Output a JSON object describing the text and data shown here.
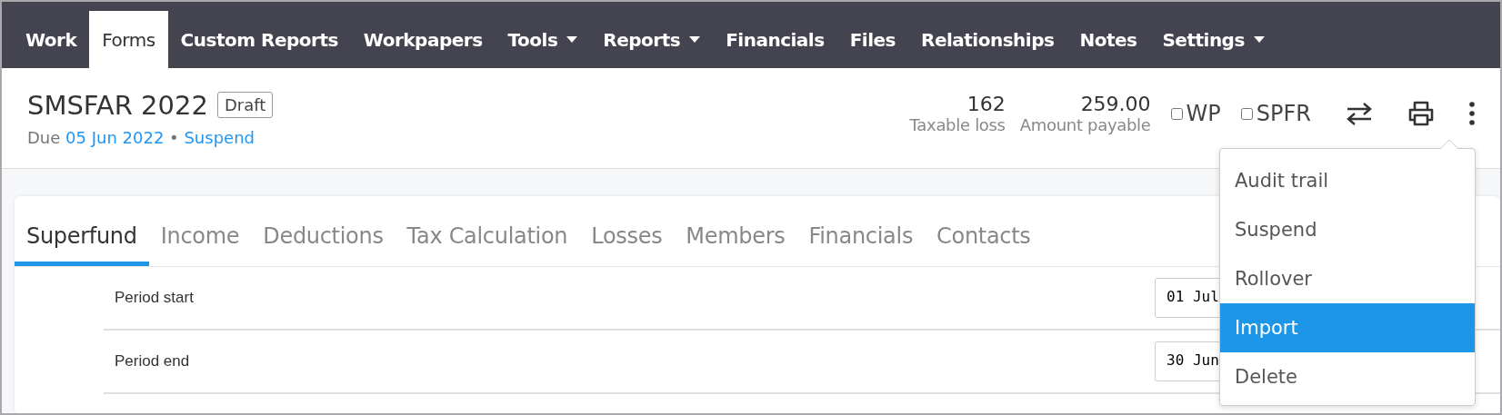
{
  "nav": [
    {
      "label": "Work",
      "selected": false,
      "dropdown": false
    },
    {
      "label": "Forms",
      "selected": true,
      "dropdown": false
    },
    {
      "label": "Custom Reports",
      "selected": false,
      "dropdown": false
    },
    {
      "label": "Workpapers",
      "selected": false,
      "dropdown": false
    },
    {
      "label": "Tools",
      "selected": false,
      "dropdown": true
    },
    {
      "label": "Reports",
      "selected": false,
      "dropdown": true
    },
    {
      "label": "Financials",
      "selected": false,
      "dropdown": false
    },
    {
      "label": "Files",
      "selected": false,
      "dropdown": false
    },
    {
      "label": "Relationships",
      "selected": false,
      "dropdown": false
    },
    {
      "label": "Notes",
      "selected": false,
      "dropdown": false
    },
    {
      "label": "Settings",
      "selected": false,
      "dropdown": true
    }
  ],
  "header": {
    "title": "SMSFAR 2022",
    "badge": "Draft",
    "due_label": "Due",
    "due_date": "05 Jun 2022",
    "separator": "•",
    "suspend_link": "Suspend",
    "stats": [
      {
        "value": "162",
        "label": "Taxable loss"
      },
      {
        "value": "259.00",
        "label": "Amount payable"
      }
    ],
    "checks": [
      {
        "label": "WP",
        "checked": false
      },
      {
        "label": "SPFR",
        "checked": false
      }
    ]
  },
  "tabs": [
    {
      "label": "Superfund",
      "selected": true
    },
    {
      "label": "Income",
      "selected": false
    },
    {
      "label": "Deductions",
      "selected": false
    },
    {
      "label": "Tax Calculation",
      "selected": false
    },
    {
      "label": "Losses",
      "selected": false
    },
    {
      "label": "Members",
      "selected": false
    },
    {
      "label": "Financials",
      "selected": false
    },
    {
      "label": "Contacts",
      "selected": false
    }
  ],
  "rows": [
    {
      "label": "Period start",
      "value": "01 Jul"
    },
    {
      "label": "Period end",
      "value": "30 Jun"
    }
  ],
  "menu": [
    {
      "label": "Audit trail",
      "selected": false
    },
    {
      "label": "Suspend",
      "selected": false
    },
    {
      "label": "Rollover",
      "selected": false
    },
    {
      "label": "Import",
      "selected": true
    },
    {
      "label": "Delete",
      "selected": false
    }
  ]
}
